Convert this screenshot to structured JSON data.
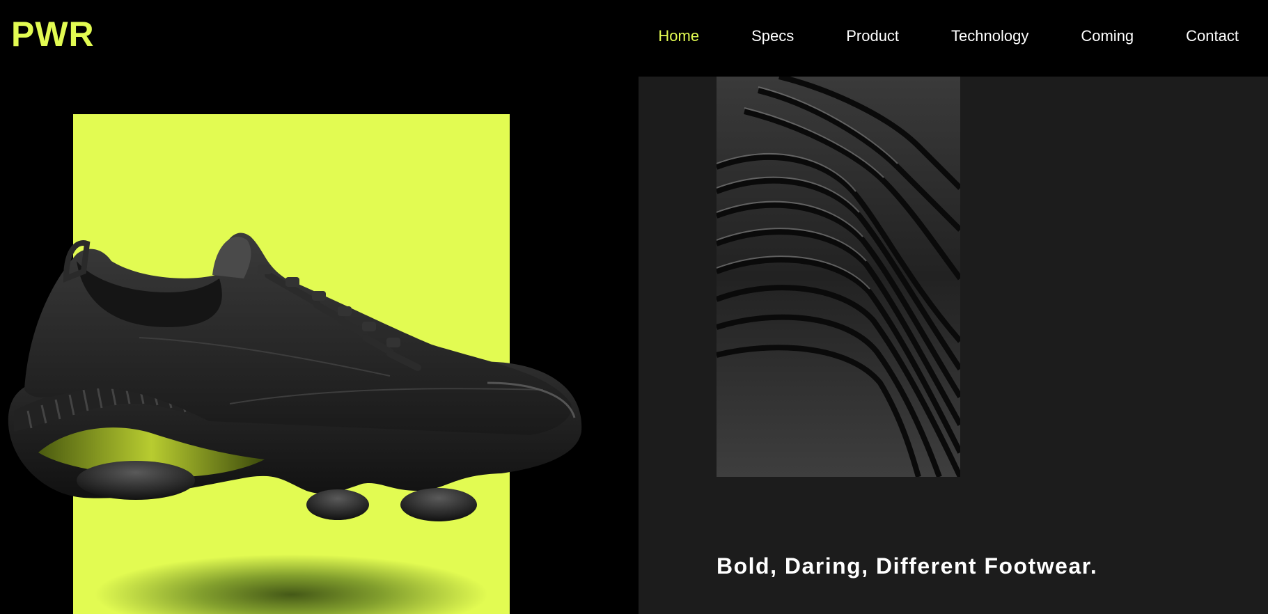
{
  "brand": {
    "logo": "PWR"
  },
  "nav": {
    "items": [
      {
        "label": "Home",
        "active": true
      },
      {
        "label": "Specs",
        "active": false
      },
      {
        "label": "Product",
        "active": false
      },
      {
        "label": "Technology",
        "active": false
      },
      {
        "label": "Coming",
        "active": false
      },
      {
        "label": "Contact",
        "active": false
      }
    ]
  },
  "hero": {
    "tagline": "Bold, Daring, Different Footwear.",
    "product_image": "black-sneaker",
    "texture_image": "black-ribbed-texture"
  },
  "colors": {
    "accent": "#e2fb52",
    "background": "#000000",
    "panel": "#1c1c1c",
    "text": "#ffffff"
  }
}
